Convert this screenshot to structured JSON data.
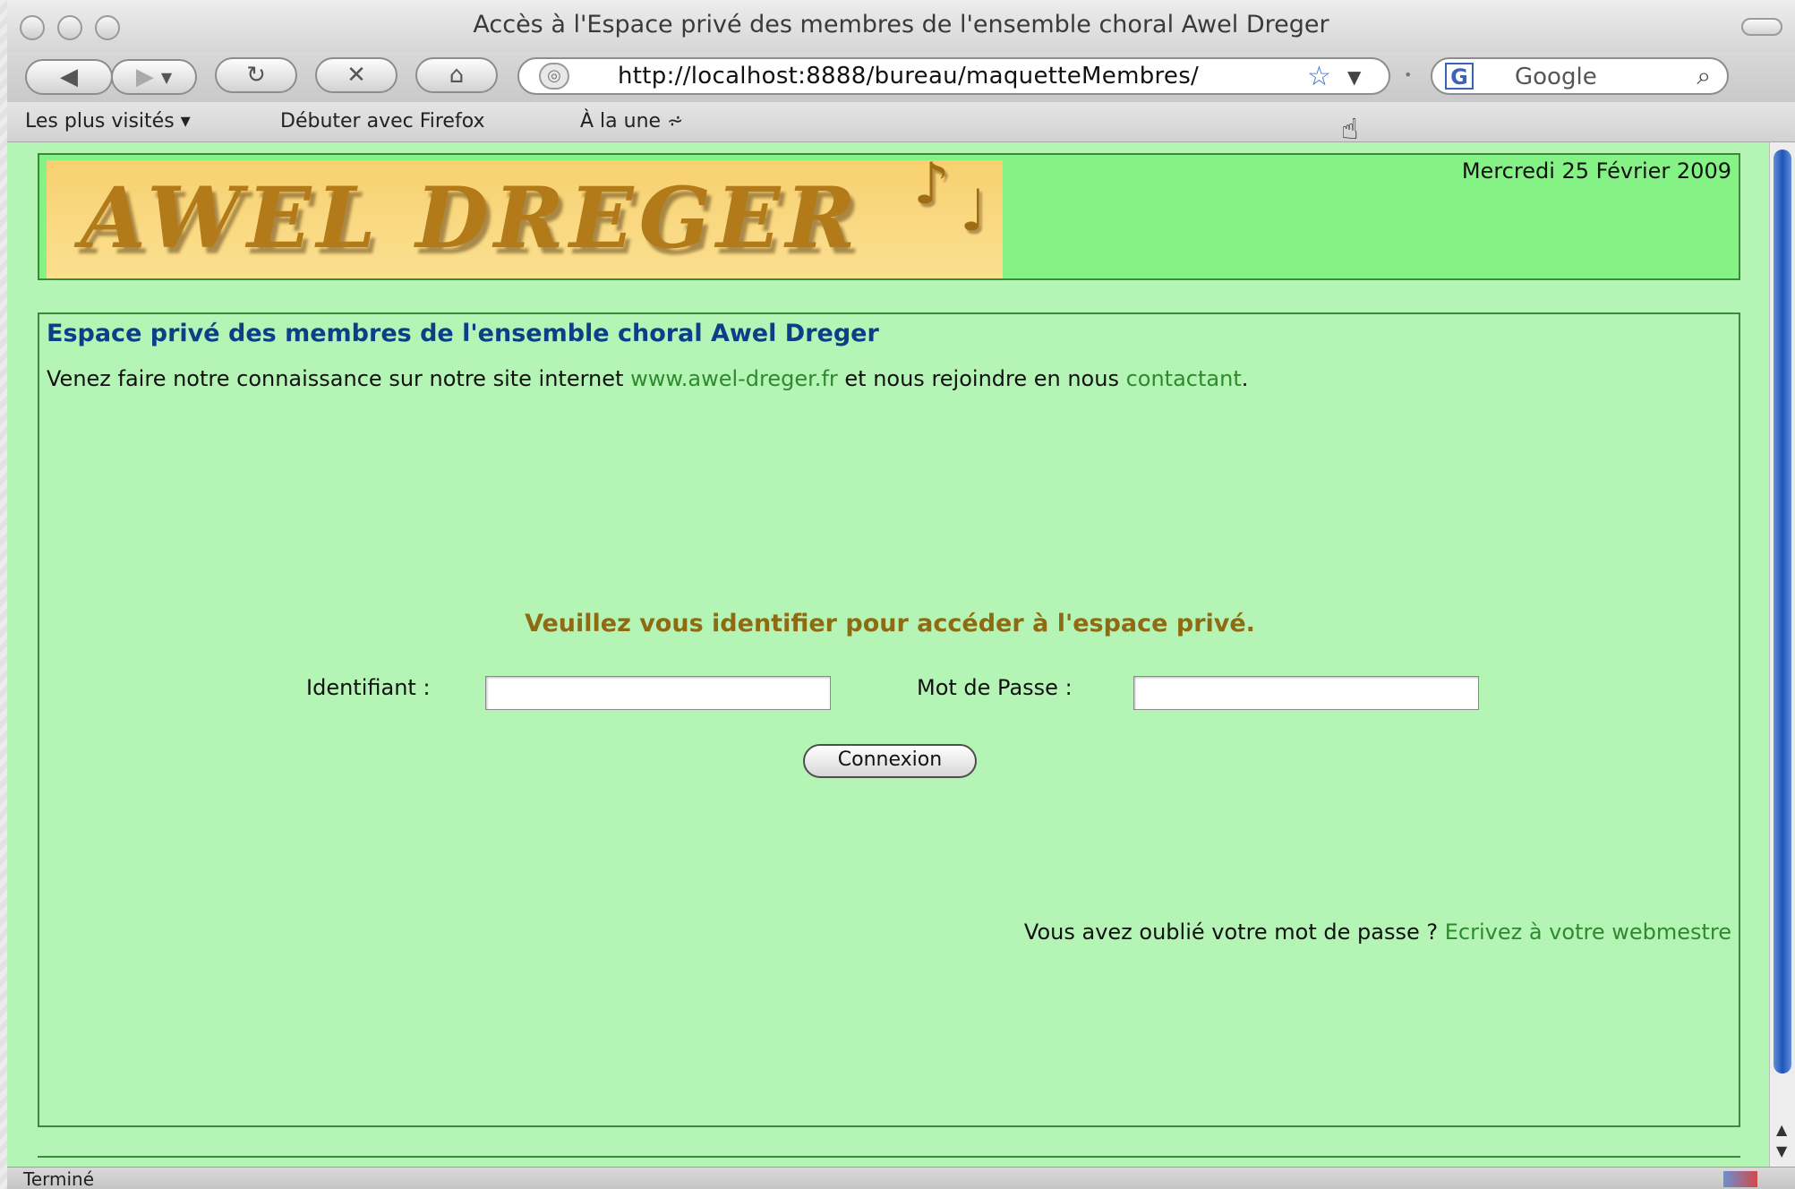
{
  "window": {
    "title": "Accès à l'Espace privé des membres de l'ensemble choral Awel Dreger"
  },
  "toolbar": {
    "url": "http://localhost:8888/bureau/maquetteMembres/",
    "search_engine": "Google"
  },
  "bookmarks": [
    {
      "label": "Les plus visités ▾"
    },
    {
      "label": "Débuter avec Firefox"
    },
    {
      "label": "À la une ⩫"
    }
  ],
  "header": {
    "logo_text": "AWEL DREGER",
    "date": "Mercredi 25 Février 2009"
  },
  "main": {
    "title": "Espace privé des membres de l'ensemble choral Awel Dreger",
    "intro_before": "Venez faire notre connaissance sur notre site internet ",
    "site_link": "www.awel-dreger.fr",
    "intro_middle": " et nous rejoindre en nous ",
    "contact_link": "contactant",
    "intro_after": ".",
    "prompt": "Veuillez vous identifier pour accéder à l'espace privé.",
    "login_label": "Identifiant :",
    "login_value": "",
    "password_label": "Mot de Passe :",
    "password_value": "",
    "submit_label": "Connexion",
    "forgot_text": "Vous avez oublié votre mot de passe ? ",
    "forgot_link": "Ecrivez à votre webmestre"
  },
  "status": {
    "text": "Terminé"
  },
  "colors": {
    "page_bg": "#b4f4b4",
    "header_bg": "#84f284",
    "title_color": "#0b3f88",
    "link_color": "#2f8a2f",
    "prompt_color": "#8f6a12"
  }
}
